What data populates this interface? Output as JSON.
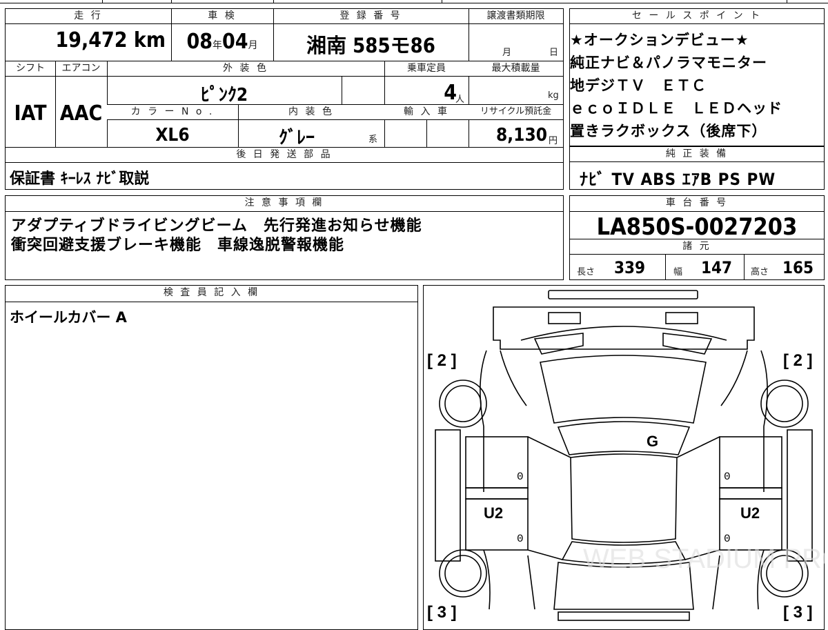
{
  "header": {
    "mileage_label": "走 行",
    "shaken_label": "車 検",
    "reg_label": "登 録 番 号",
    "transfer_label": "譲渡書類期限",
    "sales_label": "セ ー ル ス ポ イ ン ト"
  },
  "mileage": "19,472 km",
  "shaken": {
    "year": "08",
    "year_unit": "年",
    "month": "04",
    "month_unit": "月"
  },
  "registration": "湘南 585モ86",
  "transfer": {
    "month_unit": "月",
    "day_unit": "日"
  },
  "row2": {
    "shift_label": "シフト",
    "ac_label": "エアコン",
    "exterior_label": "外 装 色",
    "capacity_label": "乗車定員",
    "maxload_label": "最大積載量",
    "color_no_label": "カ ラ ー N o .",
    "interior_label": "内 装 色",
    "import_label": "輸 入 車",
    "recycle_label": "リサイクル預託金"
  },
  "shift": "IAT",
  "ac": "AAC",
  "exterior_color": "ﾋﾟﾝｸ2",
  "capacity": "4",
  "capacity_unit": "人",
  "maxload_unit": "kg",
  "color_no": "XL6",
  "interior_color": "ｸﾞﾚｰ",
  "interior_suffix": "系",
  "recycle": "8,130",
  "recycle_unit": "円",
  "later_parts_label": "後 日 発 送 部 品",
  "later_parts": "保証書 ｷｰﾚｽ ﾅﾋﾞ取説",
  "sales_points": [
    "★オークションデビュー★",
    "純正ナビ＆パノラマモニター",
    "地デジＴＶ　ＥＴＣ",
    "ｅｃｏＩＤＬＥ　ＬＥＤヘッド",
    "置きラクボックス（後席下）"
  ],
  "equipment_label": "純 正 装 備",
  "equipment": "ﾅﾋﾞ TV ABS ｴｱB PS PW",
  "notes_label": "注 意 事 項 欄",
  "notes": [
    "アダプティブドライビングビーム　先行発進お知らせ機能",
    "衝突回避支援ブレーキ機能　車線逸脱警報機能"
  ],
  "chassis_label": "車 台 番 号",
  "chassis": "LA850S-0027203",
  "specs_label": "諸 元",
  "specs": {
    "length_label": "長さ",
    "length": "339",
    "width_label": "幅",
    "width": "147",
    "height_label": "高さ",
    "height": "165"
  },
  "inspector_label": "検 査 員 記 入 欄",
  "inspector_note": "ホイールカバー A",
  "diagram": {
    "front_left": "[ 2 ]",
    "front_right": "[ 2 ]",
    "rear_left": "[ 3 ]",
    "rear_right": "[ 3 ]",
    "windshield_mark": "G",
    "left_door_mark": "U2",
    "right_door_mark": "U2",
    "zero": "0",
    "watermark": "WEB STADIUM PRO"
  }
}
